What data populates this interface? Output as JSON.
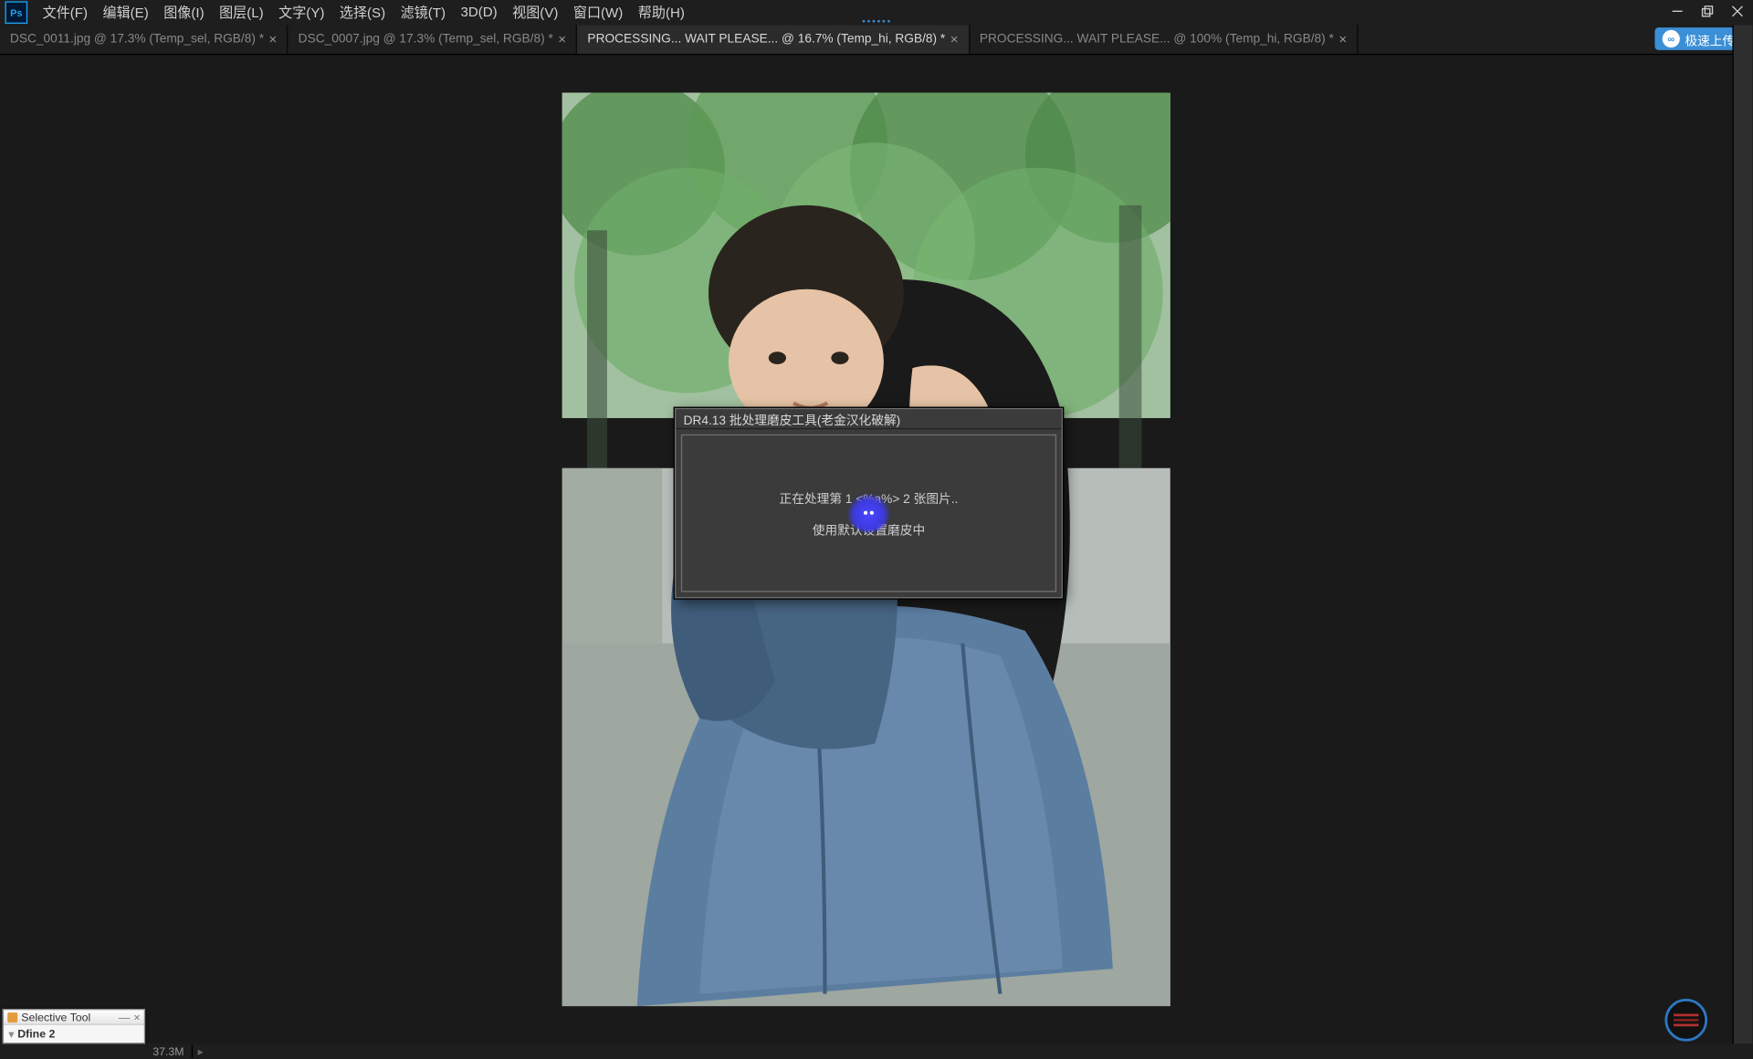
{
  "menu": {
    "items": [
      "文件(F)",
      "编辑(E)",
      "图像(I)",
      "图层(L)",
      "文字(Y)",
      "选择(S)",
      "滤镜(T)",
      "3D(D)",
      "视图(V)",
      "窗口(W)",
      "帮助(H)"
    ]
  },
  "tabs": [
    {
      "label": "DSC_0011.jpg @ 17.3% (Temp_sel, RGB/8) *",
      "active": false
    },
    {
      "label": "DSC_0007.jpg @ 17.3% (Temp_sel, RGB/8) *",
      "active": false
    },
    {
      "label": "PROCESSING... WAIT PLEASE... @ 16.7% (Temp_hi, RGB/8) *",
      "active": true
    },
    {
      "label": "PROCESSING... WAIT PLEASE... @ 100% (Temp_hi, RGB/8) *",
      "active": false
    }
  ],
  "upload_button": "极速上传",
  "dialog": {
    "title": "DR4.13 批处理磨皮工具(老金汉化破解)",
    "line1": "正在处理第 1 <%a%> 2 张图片..",
    "line2": "使用默认设置磨皮中"
  },
  "status": {
    "size": "37.3M"
  },
  "selective_tool": {
    "title": "Selective Tool",
    "body": "Dfine 2"
  }
}
